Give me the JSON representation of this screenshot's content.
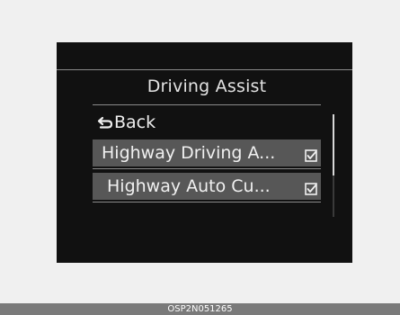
{
  "menu": {
    "title": "Driving Assist",
    "back_label": "Back",
    "items": [
      {
        "label": "Highway Driving A...",
        "checked": true
      },
      {
        "label": "Highway Auto Cu...",
        "checked": true
      }
    ],
    "scroll_fraction_visible": 0.6
  },
  "caption": {
    "code": "OSP2N051265"
  },
  "icons": {
    "back": "return-arrow-icon",
    "check": "checkbox-checked-icon"
  },
  "colors": {
    "screen_background": "#111111",
    "selected_row": "#575757",
    "text": "#eeeeee",
    "caption_bar": "#7a7a7a"
  }
}
